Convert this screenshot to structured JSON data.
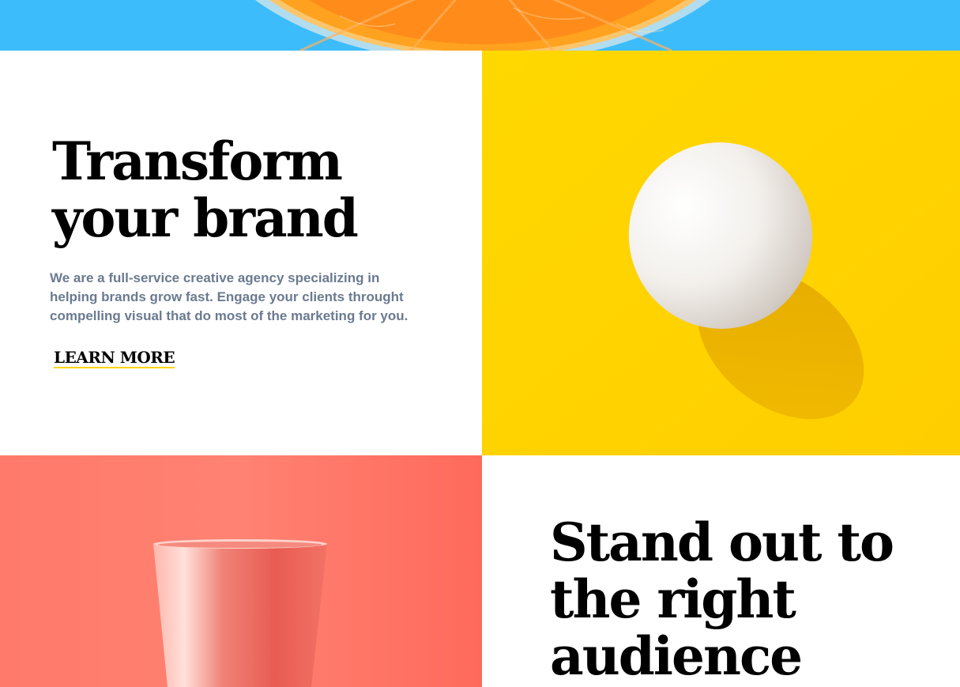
{
  "sections": {
    "transform": {
      "headline_line1": "Transform",
      "headline_line2": "your brand",
      "body": "We are a full-service creative agency specializing in helping brands grow fast. Engage your clients throught compelling visual that do most of the marketing for you.",
      "cta_label": "LEARN MORE"
    },
    "standout": {
      "headline_line1": "Stand out to",
      "headline_line2": "the right",
      "headline_line3": "audience"
    }
  },
  "images": {
    "top_banner": "orange-slice-photo",
    "middle_right": "egg-photo",
    "bottom_left": "cup-photo"
  },
  "colors": {
    "banner_blue": "#3dbcfb",
    "egg_yellow": "#ffd400",
    "cup_coral": "#ff6f61",
    "cta_underline": "#ffd400",
    "body_text": "#6b7a90",
    "headline": "#000000"
  }
}
